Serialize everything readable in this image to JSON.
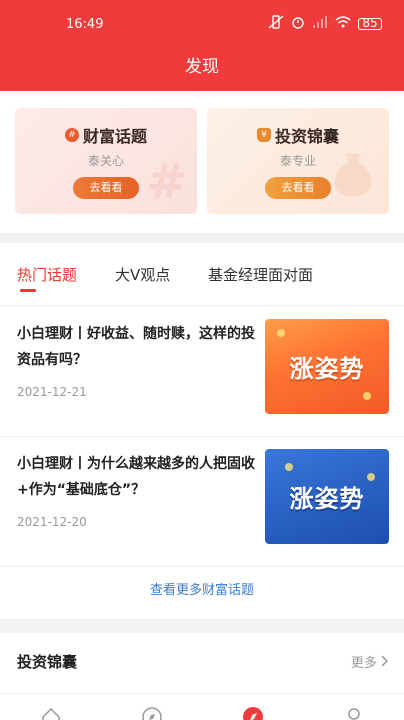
{
  "status": {
    "time": "16:49",
    "battery": "85"
  },
  "header": {
    "title": "发现"
  },
  "cards": [
    {
      "title": "财富话题",
      "subtitle": "泰关心",
      "button": "去看看",
      "icon": "hashtag-icon"
    },
    {
      "title": "投资锦囊",
      "subtitle": "泰专业",
      "button": "去看看",
      "icon": "money-bag-icon"
    }
  ],
  "tabs": [
    {
      "label": "热门话题",
      "active": true
    },
    {
      "label": "大V观点",
      "active": false
    },
    {
      "label": "基金经理面对面",
      "active": false
    }
  ],
  "articles": [
    {
      "title": "小白理财丨好收益、随时赎，这样的投资品有吗？",
      "date": "2021-12-21",
      "thumb_text": "涨姿势"
    },
    {
      "title": "小白理财丨为什么越来越多的人把固收+作为“基础底仓”？",
      "date": "2021-12-20",
      "thumb_text": "涨姿势"
    }
  ],
  "more_link": "查看更多财富话题",
  "section2": {
    "title": "投资锦囊",
    "more": "更多"
  },
  "colors": {
    "brand_red": "#ef3b3b",
    "link_blue": "#3a7fd1"
  }
}
